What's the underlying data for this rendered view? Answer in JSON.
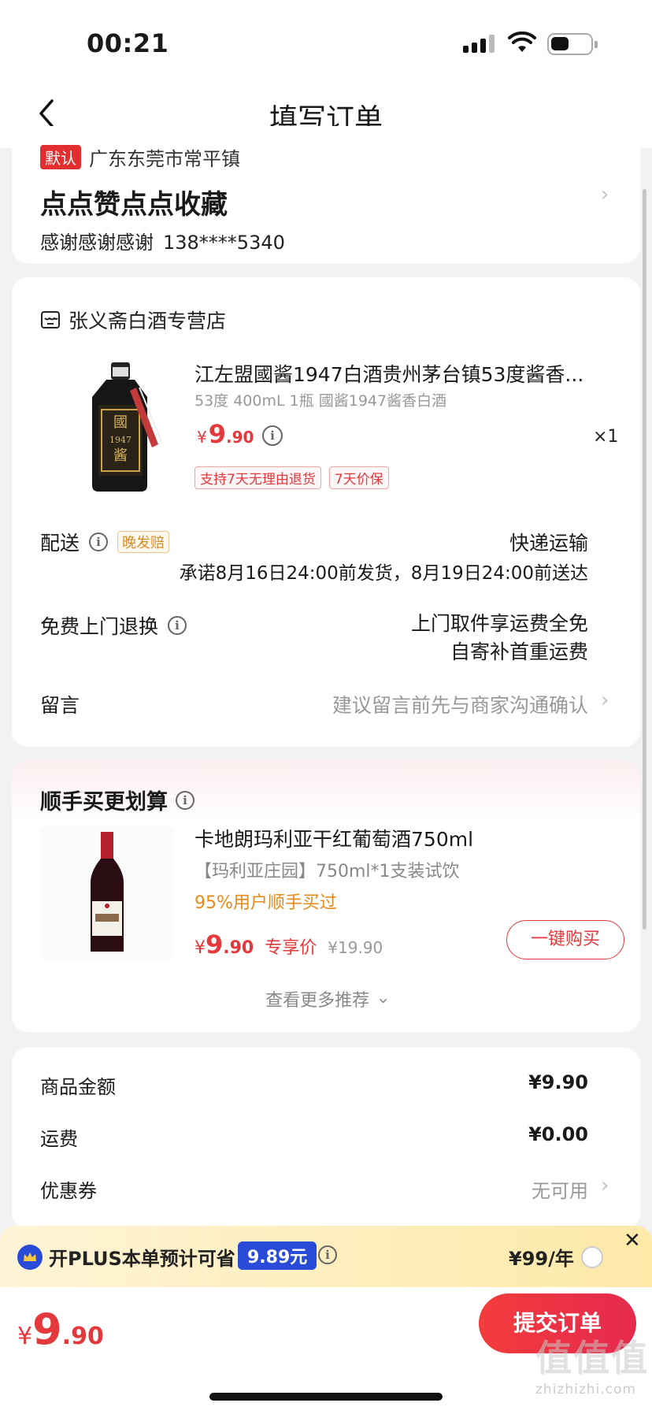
{
  "status_bar": {
    "time": "00:21"
  },
  "nav": {
    "title": "填写订单"
  },
  "address": {
    "default_badge": "默认",
    "region": "广东东莞市常平镇",
    "name": "点点赞点点收藏",
    "contact": "感谢感谢感谢",
    "phone": "138****5340"
  },
  "shop": {
    "name": "张义斋白酒专营店",
    "product": {
      "title": "江左盟國酱1947白酒贵州茅台镇53度酱香...",
      "spec": "53度 400mL 1瓶 國酱1947酱香白酒",
      "price_currency": "¥",
      "price_int": "9",
      "price_dec": ".90",
      "quantity": "×1",
      "service_tags": [
        "支持7天无理由退货",
        "7天价保"
      ]
    },
    "delivery": {
      "label": "配送",
      "badge": "晚发赔",
      "method": "快递运输",
      "promise": "承诺8月16日24:00前发货，8月19日24:00前送达"
    },
    "return": {
      "label": "免费上门退换",
      "line1": "上门取件享运费全免",
      "line2": "自寄补首重运费"
    },
    "message": {
      "label": "留言",
      "placeholder": "建议留言前先与商家沟通确认"
    }
  },
  "recommend": {
    "title": "顺手买更划算",
    "item": {
      "title": "卡地朗玛利亚干红葡萄酒750ml",
      "spec": "【玛利亚庄园】750ml*1支装试饮",
      "popularity": "95%用户顺手买过",
      "price_currency": "¥",
      "price_int": "9",
      "price_dec": ".90",
      "price_tag": "专享价",
      "original_price": "¥19.90",
      "buy_button": "一键购买"
    },
    "more": "查看更多推荐"
  },
  "summary": {
    "goods_label": "商品金额",
    "goods_value": "¥9.90",
    "shipping_label": "运费",
    "shipping_value": "¥0.00",
    "coupon_label": "优惠券",
    "coupon_value": "无可用"
  },
  "plus": {
    "text": "开PLUS本单预计可省",
    "amount": "9.89元",
    "price": "¥99/年"
  },
  "bottom": {
    "currency": "¥",
    "total_int": "9",
    "total_dec": ".90",
    "submit": "提交订单",
    "watermark": "值值值",
    "watermark_sub": "zhizhizhi.com"
  },
  "colors": {
    "accent_red": "#e4393c",
    "plus_blue": "#2a4bd7",
    "orange": "#e8891a"
  }
}
